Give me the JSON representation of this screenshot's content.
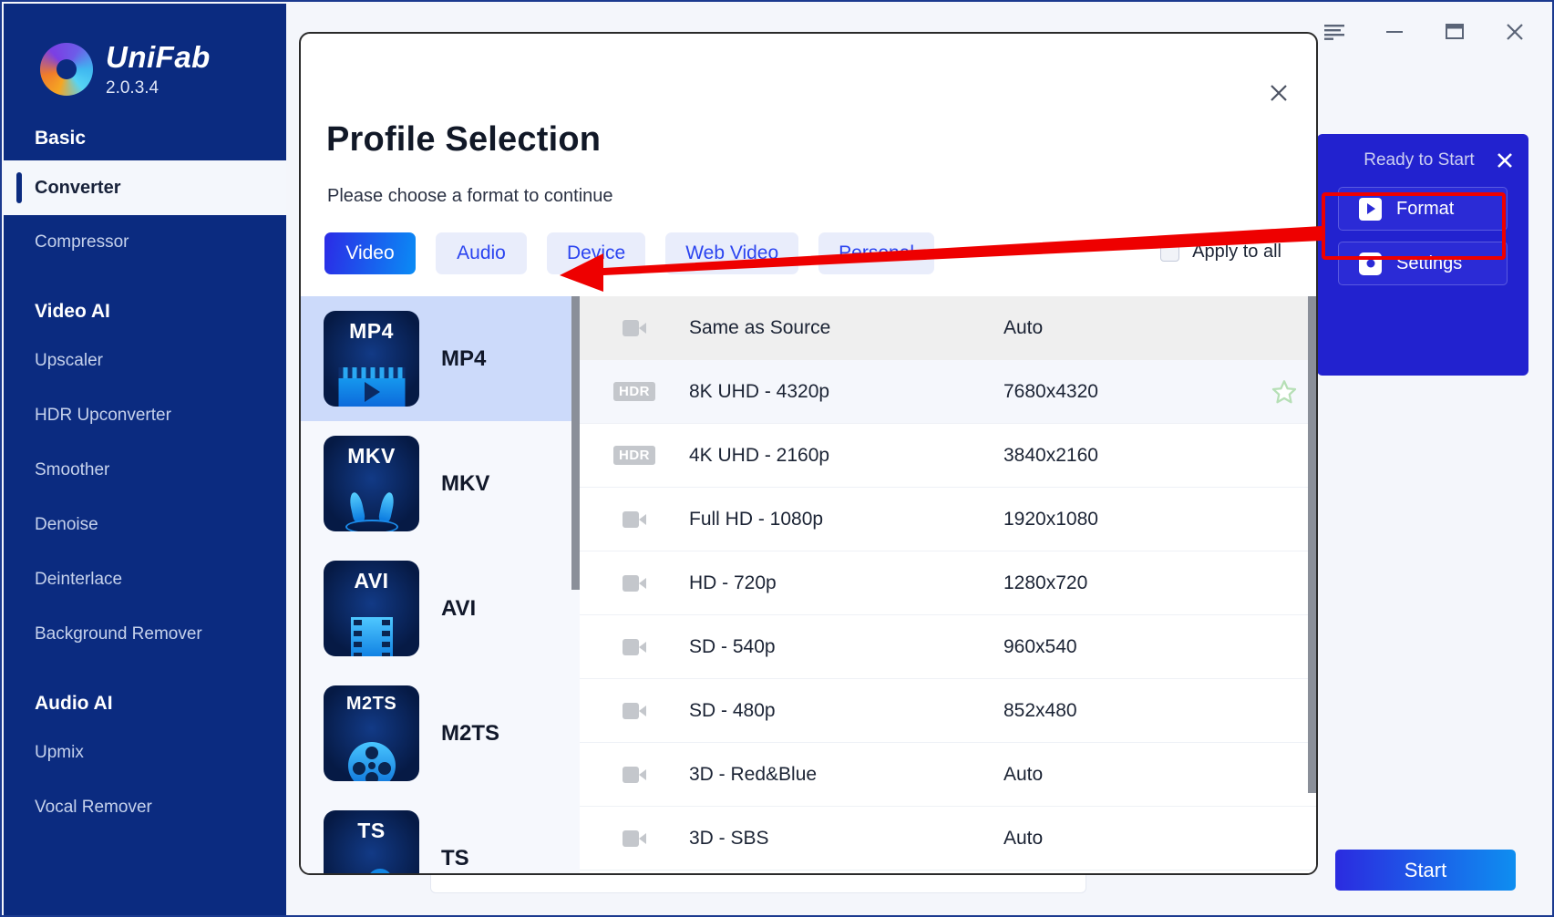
{
  "app": {
    "name": "UniFab",
    "version": "2.0.3.4"
  },
  "titlebar": {
    "menu_label": "menu-icon",
    "minimize_label": "minimize-icon",
    "maximize_label": "maximize-icon",
    "close_label": "close-icon"
  },
  "sidebar": {
    "groups": [
      {
        "title": "Basic",
        "items": [
          {
            "label": "Converter",
            "active": true
          },
          {
            "label": "Compressor",
            "active": false
          }
        ]
      },
      {
        "title": "Video AI",
        "items": [
          {
            "label": "Upscaler",
            "active": false
          },
          {
            "label": "HDR Upconverter",
            "active": false
          },
          {
            "label": "Smoother",
            "active": false
          },
          {
            "label": "Denoise",
            "active": false
          },
          {
            "label": "Deinterlace",
            "active": false
          },
          {
            "label": "Background Remover",
            "active": false
          }
        ]
      },
      {
        "title": "Audio AI",
        "items": [
          {
            "label": "Upmix",
            "active": false
          },
          {
            "label": "Vocal Remover",
            "active": false
          }
        ]
      }
    ]
  },
  "dialog": {
    "title": "Profile Selection",
    "subtitle": "Please choose a format to continue",
    "close_label": "close-icon",
    "tabs": [
      {
        "label": "Video",
        "active": true
      },
      {
        "label": "Audio",
        "active": false
      },
      {
        "label": "Device",
        "active": false
      },
      {
        "label": "Web Video",
        "active": false
      },
      {
        "label": "Personal",
        "active": false
      }
    ],
    "apply_to_all": {
      "label": "Apply to all",
      "checked": false
    },
    "formats": [
      {
        "label": "MP4",
        "tag": "MP4",
        "active": true
      },
      {
        "label": "MKV",
        "tag": "MKV",
        "active": false
      },
      {
        "label": "AVI",
        "tag": "AVI",
        "active": false
      },
      {
        "label": "M2TS",
        "tag": "M2TS",
        "active": false
      },
      {
        "label": "TS",
        "tag": "TS",
        "active": false
      }
    ],
    "resolutions": [
      {
        "name": "Same as Source",
        "dimensions": "Auto",
        "icon": "camera-icon",
        "selected": true,
        "starred": false
      },
      {
        "name": "8K UHD - 4320p",
        "dimensions": "7680x4320",
        "icon": "hdr-badge",
        "selected": false,
        "starred": true
      },
      {
        "name": "4K UHD - 2160p",
        "dimensions": "3840x2160",
        "icon": "hdr-badge",
        "selected": false,
        "starred": false
      },
      {
        "name": "Full HD - 1080p",
        "dimensions": "1920x1080",
        "icon": "camera-icon",
        "selected": false,
        "starred": false
      },
      {
        "name": "HD - 720p",
        "dimensions": "1280x720",
        "icon": "camera-icon",
        "selected": false,
        "starred": false
      },
      {
        "name": "SD - 540p",
        "dimensions": "960x540",
        "icon": "camera-icon",
        "selected": false,
        "starred": false
      },
      {
        "name": "SD - 480p",
        "dimensions": "852x480",
        "icon": "camera-icon",
        "selected": false,
        "starred": false
      },
      {
        "name": "3D - Red&Blue",
        "dimensions": "Auto",
        "icon": "camera-icon",
        "selected": false,
        "starred": false
      },
      {
        "name": "3D - SBS",
        "dimensions": "Auto",
        "icon": "camera-icon",
        "selected": false,
        "starred": false
      }
    ]
  },
  "ready_panel": {
    "title": "Ready to Start",
    "close_label": "close-icon",
    "format_button": "Format",
    "settings_button": "Settings"
  },
  "start_button": {
    "label": "Start"
  },
  "colors": {
    "sidebar_bg": "#0b2b80",
    "accent_blue": "#2b2be6",
    "accent_cyan": "#0a8cf5",
    "panel_blue": "#2222cf",
    "annotation_red": "#ee0000",
    "star_green": "#b6dfb6",
    "tab_inactive_bg": "#e9edfb",
    "format_active_bg": "#ccdafa"
  }
}
